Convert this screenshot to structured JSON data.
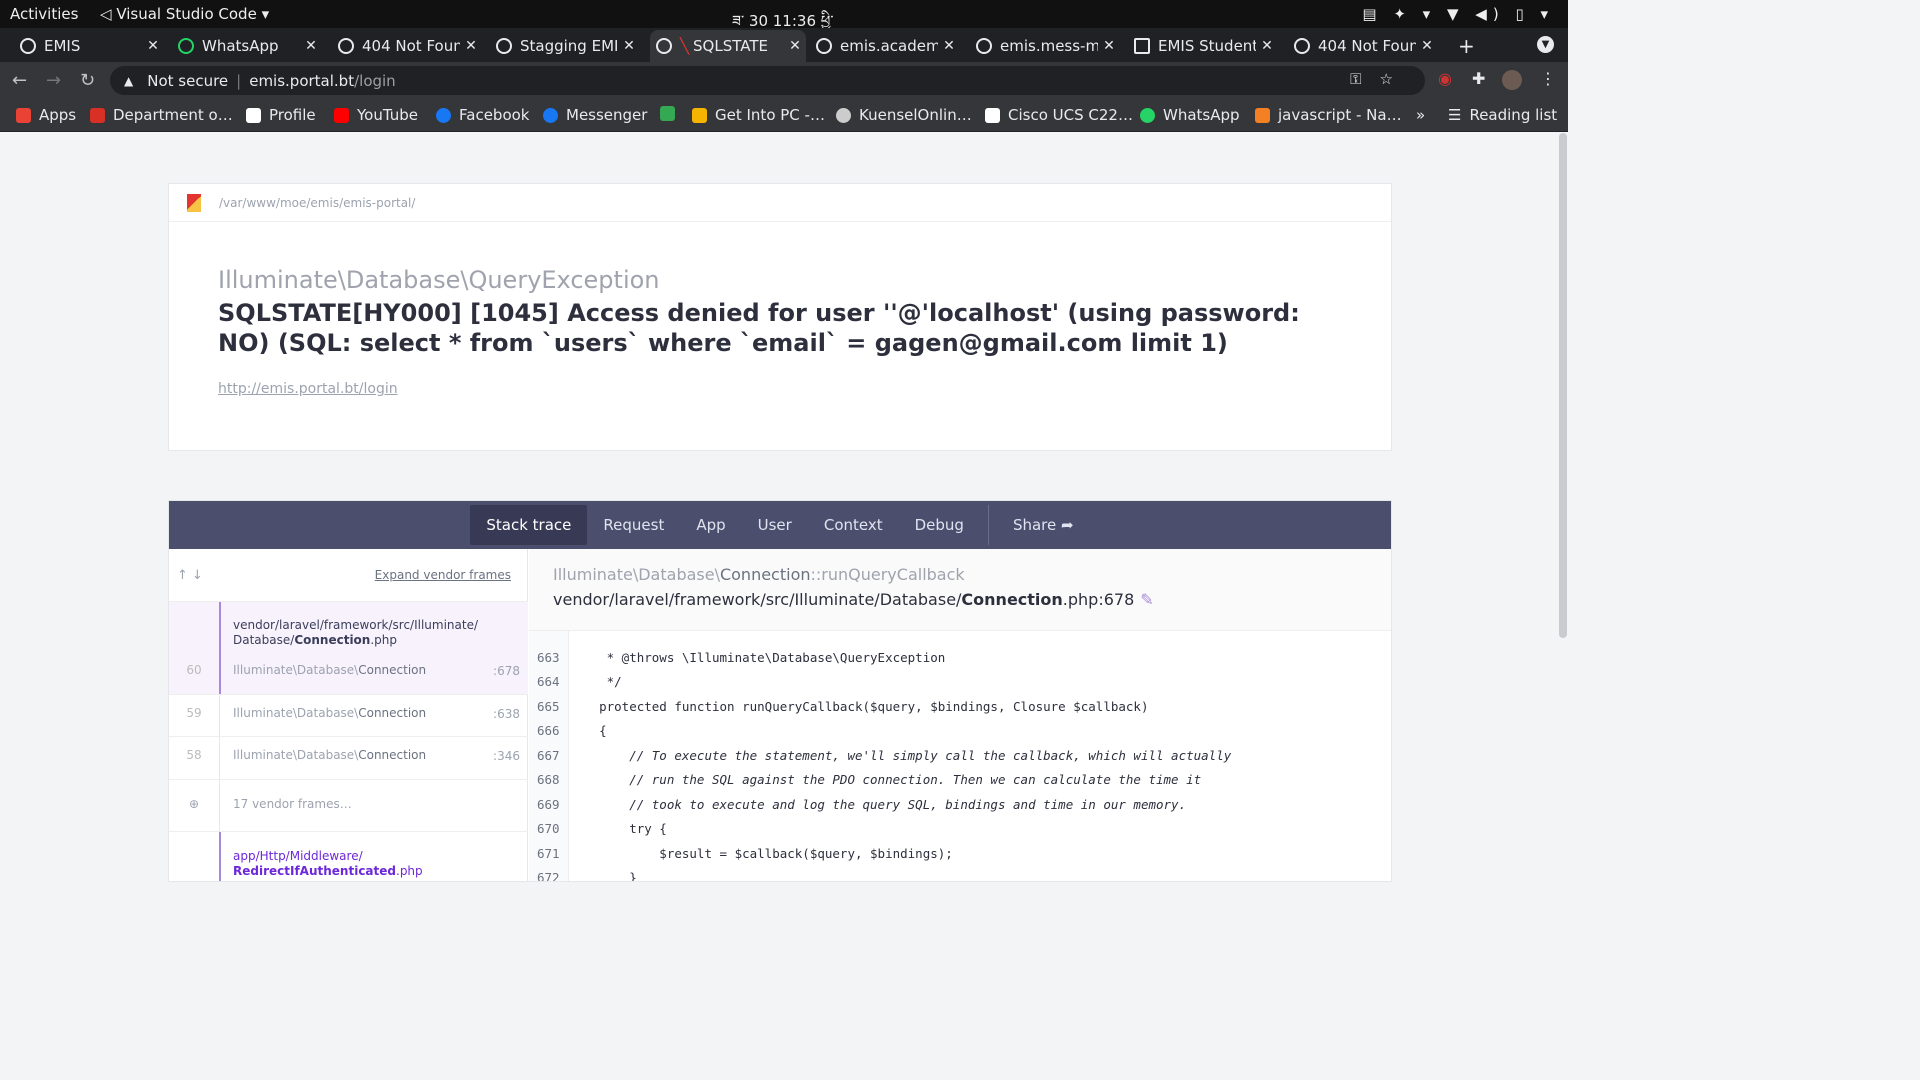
{
  "system": {
    "activities": "Activities",
    "app": "Visual Studio Code",
    "clock": "ཟ་ 30  11:36 ཕྱི་"
  },
  "tabs": [
    {
      "title": "EMIS"
    },
    {
      "title": "WhatsApp"
    },
    {
      "title": "404 Not Foun"
    },
    {
      "title": "Stagging EMI"
    },
    {
      "title": "SQLSTATE"
    },
    {
      "title": "emis.academ"
    },
    {
      "title": "emis.mess-m"
    },
    {
      "title": "EMIS Student"
    },
    {
      "title": "404 Not Foun"
    }
  ],
  "omnibox": {
    "security": "Not secure",
    "host": "emis.portal.bt",
    "path": "/login"
  },
  "bookmarks": [
    {
      "label": "Apps",
      "color": "#ea4335"
    },
    {
      "label": "Department o…",
      "color": "#d93025"
    },
    {
      "label": "Profile",
      "color": "#ffffff"
    },
    {
      "label": "YouTube",
      "color": "#ff0000"
    },
    {
      "label": "Facebook",
      "color": "#1877f2"
    },
    {
      "label": "Messenger",
      "color": "#1877f2"
    },
    {
      "label": "",
      "color": "#34a853"
    },
    {
      "label": "Get Into PC -…",
      "color": "#f4b400"
    },
    {
      "label": "KuenselOnlin…",
      "color": "#cccccc"
    },
    {
      "label": "Cisco UCS C22…",
      "color": "#ffffff"
    },
    {
      "label": "WhatsApp",
      "color": "#25d366"
    },
    {
      "label": "javascript - Na…",
      "color": "#f48024"
    }
  ],
  "reading_list": "Reading list",
  "error": {
    "path": "/var/www/moe/emis/emis-portal/",
    "exception": "Illuminate\\Database\\QueryException",
    "message": "SQLSTATE[HY000] [1045] Access denied for user ''@'localhost' (using password: NO) (SQL: select * from `users` where `email` = gagen@gmail.com limit 1)",
    "url": "http://emis.portal.bt/login"
  },
  "panel_tabs": [
    "Stack trace",
    "Request",
    "App",
    "User",
    "Context",
    "Debug"
  ],
  "share": "Share",
  "expand_vendor": "Expand vendor frames",
  "frames": [
    {
      "num": "60",
      "file": "vendor/laravel/framework/src/Illuminate/",
      "file2": "Database/",
      "file_bold": "Connection",
      "file_ext": ".php",
      "cls_ns": "Illuminate\\Database\\",
      "cls": "Connection",
      "line": ":678"
    },
    {
      "num": "59",
      "cls_ns": "Illuminate\\Database\\",
      "cls": "Connection",
      "line": ":638"
    },
    {
      "num": "58",
      "cls_ns": "Illuminate\\Database\\",
      "cls": "Connection",
      "line": ":346"
    },
    {
      "vendor": "17 vendor frames…"
    },
    {
      "file": "app/Http/Middleware/",
      "file_bold": "RedirectIfAuthenticated",
      "file_ext": ".php"
    }
  ],
  "detail": {
    "cls_ns": "Illuminate\\Database\\",
    "cls": "Connection",
    "method": "::runQueryCallback",
    "file_path": "vendor/laravel/framework/src/Illuminate/Database/",
    "file_bold": "Connection",
    "file_ext": ".php:678"
  },
  "code_lines": [
    {
      "n": "663",
      "t": "     * @throws \\Illuminate\\Database\\QueryException"
    },
    {
      "n": "664",
      "t": "     */"
    },
    {
      "n": "665",
      "t": "    protected function runQueryCallback($query, $bindings, Closure $callback)"
    },
    {
      "n": "666",
      "t": "    {"
    },
    {
      "n": "667",
      "t": "        // To execute the statement, we'll simply call the callback, which will actually"
    },
    {
      "n": "668",
      "t": "        // run the SQL against the PDO connection. Then we can calculate the time it"
    },
    {
      "n": "669",
      "t": "        // took to execute and log the query SQL, bindings and time in our memory."
    },
    {
      "n": "670",
      "t": "        try {"
    },
    {
      "n": "671",
      "t": "            $result = $callback($query, $bindings);"
    },
    {
      "n": "672",
      "t": "        }"
    }
  ]
}
